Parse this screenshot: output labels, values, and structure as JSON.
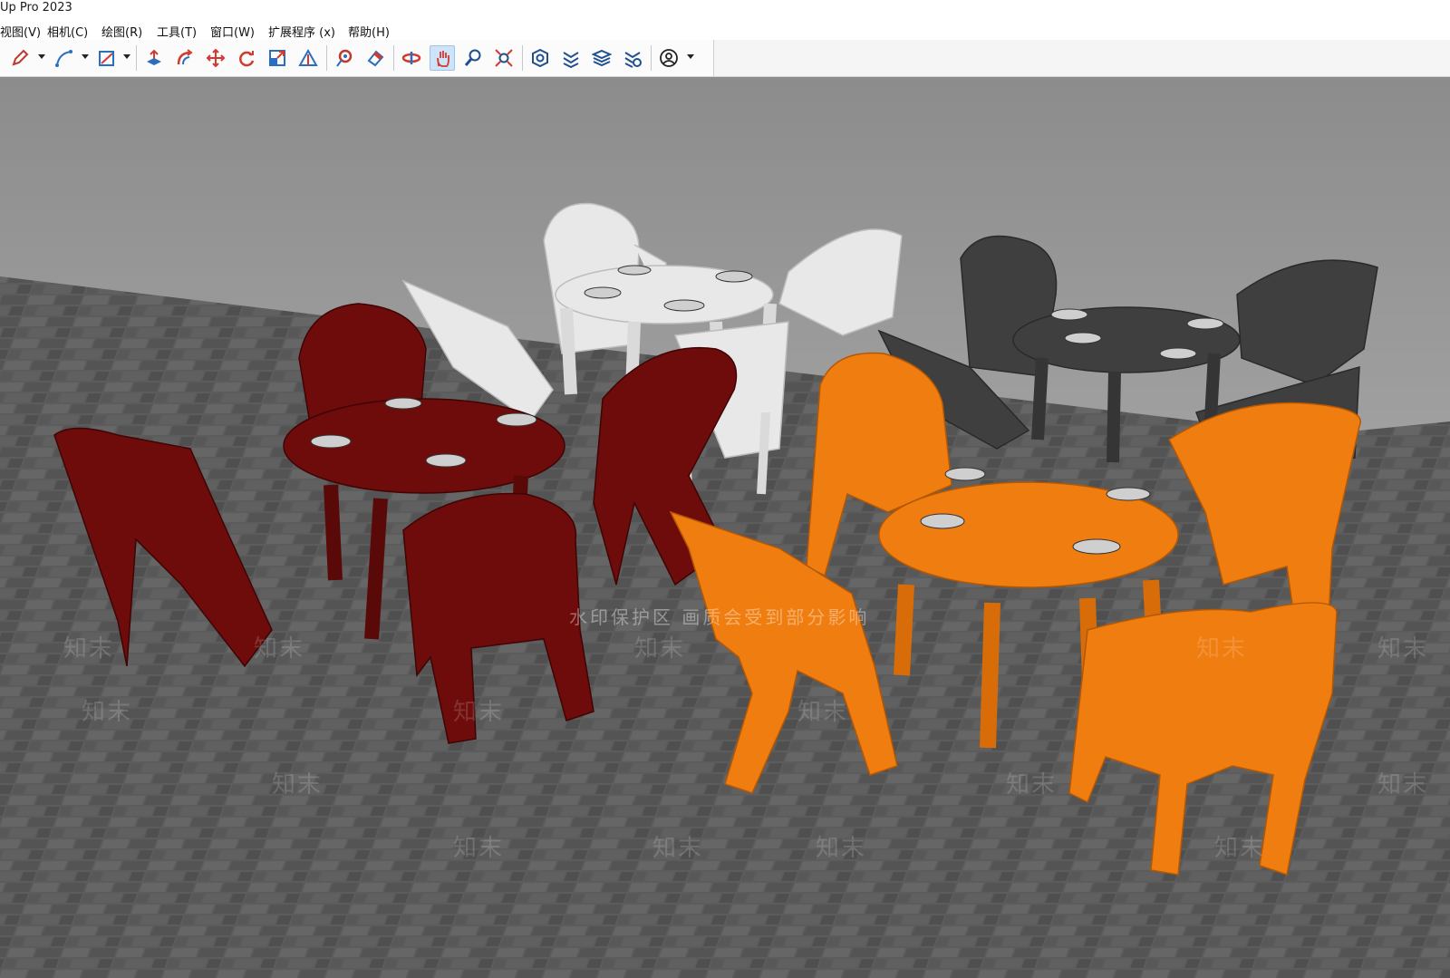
{
  "window": {
    "title": "Up Pro 2023"
  },
  "menu": {
    "items": [
      {
        "label": "视图(V)"
      },
      {
        "label": "相机(C)"
      },
      {
        "label": "绘图(R)"
      },
      {
        "label": "工具(T)"
      },
      {
        "label": "窗口(W)"
      },
      {
        "label": "扩展程序 (x)"
      },
      {
        "label": "帮助(H)"
      }
    ]
  },
  "toolbar": {
    "tools": [
      {
        "icon": "pencil-icon",
        "color": "#c0392b"
      },
      {
        "icon": "arc-icon",
        "color": "#2a6fbf"
      },
      {
        "icon": "rectangle-icon",
        "color": "#2a6fbf"
      },
      {
        "icon": "push-pull-icon",
        "color": "#d13a2f"
      },
      {
        "icon": "follow-me-icon",
        "color": "#d13a2f"
      },
      {
        "icon": "move-icon",
        "color": "#d13a2f"
      },
      {
        "icon": "rotate-icon",
        "color": "#d13a2f"
      },
      {
        "icon": "scale-icon",
        "color": "#2a6fbf"
      },
      {
        "icon": "tape-measure-icon",
        "color": "#2a6fbf"
      },
      {
        "icon": "paint-bucket-icon",
        "color": "#c0392b"
      },
      {
        "icon": "eraser-icon",
        "color": "#2a6fbf"
      },
      {
        "icon": "orbit-icon",
        "color": "#d13a2f"
      },
      {
        "icon": "pan-icon",
        "color": "#d13a2f",
        "active": true
      },
      {
        "icon": "zoom-icon",
        "color": "#1f4f8f"
      },
      {
        "icon": "zoom-extents-icon",
        "color": "#d13a2f"
      },
      {
        "icon": "warehouse-icon",
        "color": "#1f4f8f"
      },
      {
        "icon": "extension-warehouse-icon",
        "color": "#1f4f8f"
      },
      {
        "icon": "layers-icon",
        "color": "#1f4f8f"
      },
      {
        "icon": "settings-extension-icon",
        "color": "#1f4f8f"
      },
      {
        "icon": "account-icon",
        "color": "#222222"
      }
    ]
  },
  "viewport": {
    "watermark_strip": "水印保护区  画质会受到部分影响",
    "watermark_text": "知末"
  },
  "colors": {
    "dark_red_set": "#6e0b0b",
    "white_set": "#e6e6e6",
    "gray_set": "#3d3d3d",
    "orange_set": "#f07d10",
    "wall": "#939393",
    "floor": "#5a5a5a"
  }
}
